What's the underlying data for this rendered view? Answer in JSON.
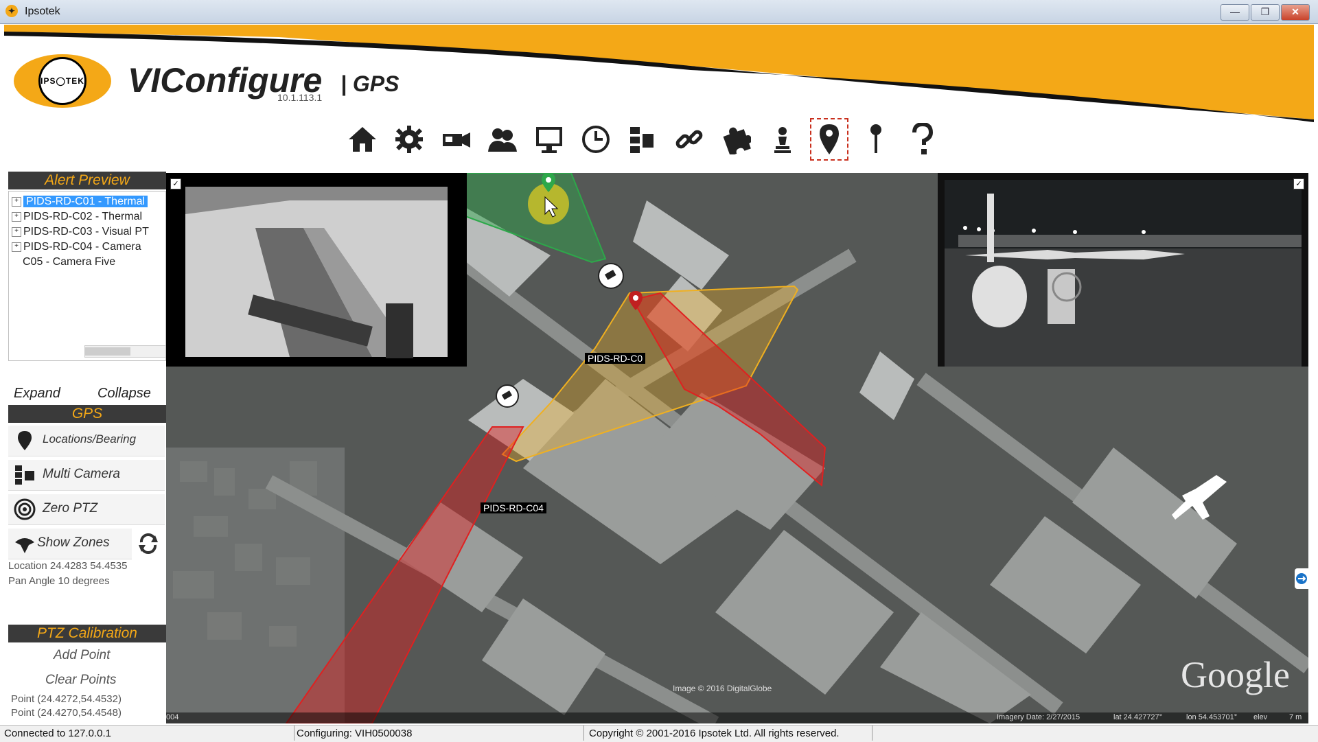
{
  "window": {
    "title": "Ipsotek",
    "minimize": "—",
    "restore": "❐",
    "close": "✕"
  },
  "header": {
    "logo_text": "IPS◯TEK",
    "app_name": "VIConfigure",
    "app_sub": "| GPS",
    "version": "10.1.113.1"
  },
  "toolbar": {
    "icons": [
      "home-icon",
      "gear-icon",
      "camera-icon",
      "users-icon",
      "monitor-icon",
      "clock-icon",
      "multi-camera-icon",
      "link-icon",
      "puzzle-icon",
      "chess-pawn-icon",
      "map-pin-icon",
      "location-pin-icon",
      "help-icon"
    ],
    "selected": "map-pin-icon"
  },
  "left": {
    "alert_preview": "Alert Preview",
    "tree": [
      {
        "label": "PIDS-RD-C01 - Thermal",
        "selected": true,
        "expandable": true
      },
      {
        "label": "PIDS-RD-C02 - Thermal",
        "selected": false,
        "expandable": true
      },
      {
        "label": "PIDS-RD-C03 - Visual PT",
        "selected": false,
        "expandable": true
      },
      {
        "label": "PIDS-RD-C04 - Camera",
        "selected": false,
        "expandable": true
      },
      {
        "label": "C05 - Camera Five",
        "selected": false,
        "expandable": false
      }
    ],
    "expand": "Expand",
    "collapse": "Collapse",
    "gps_header": "GPS",
    "buttons": {
      "locations": "Locations/Bearing",
      "multi_camera": "Multi Camera",
      "zero_ptz": "Zero PTZ",
      "show_zones": "Show Zones"
    },
    "location_info": "Location 24.4283 54.4535",
    "pan_info": "Pan Angle 10 degrees",
    "ptz_header": "PTZ Calibration",
    "add_point": "Add Point",
    "clear_points": "Clear Points",
    "points": [
      "Point (24.4272,54.4532)",
      "Point (24.4270,54.4548)"
    ]
  },
  "map": {
    "camera_labels": [
      "PIDS-RD-C0",
      "PIDS-RD-C04"
    ],
    "imagery_credit": "Image © 2016 DigitalGlobe",
    "google": "Google",
    "scale_left": "004",
    "imagery_date": "Imagery Date: 2/27/2015",
    "lat": "lat  24.427727°",
    "lon": "lon  54.453701°",
    "elev": "elev",
    "elev_value": "7 m"
  },
  "status": {
    "connected": "Connected to 127.0.0.1",
    "configuring": "Configuring: VIH0500038",
    "copyright": "Copyright © 2001-2016 Ipsotek Ltd. All rights reserved."
  },
  "colors": {
    "accent": "#f4a817",
    "zone_red": "#e02020",
    "zone_green": "#2da84a",
    "zone_yellow": "#f0b020",
    "select_blue": "#3399ff"
  }
}
